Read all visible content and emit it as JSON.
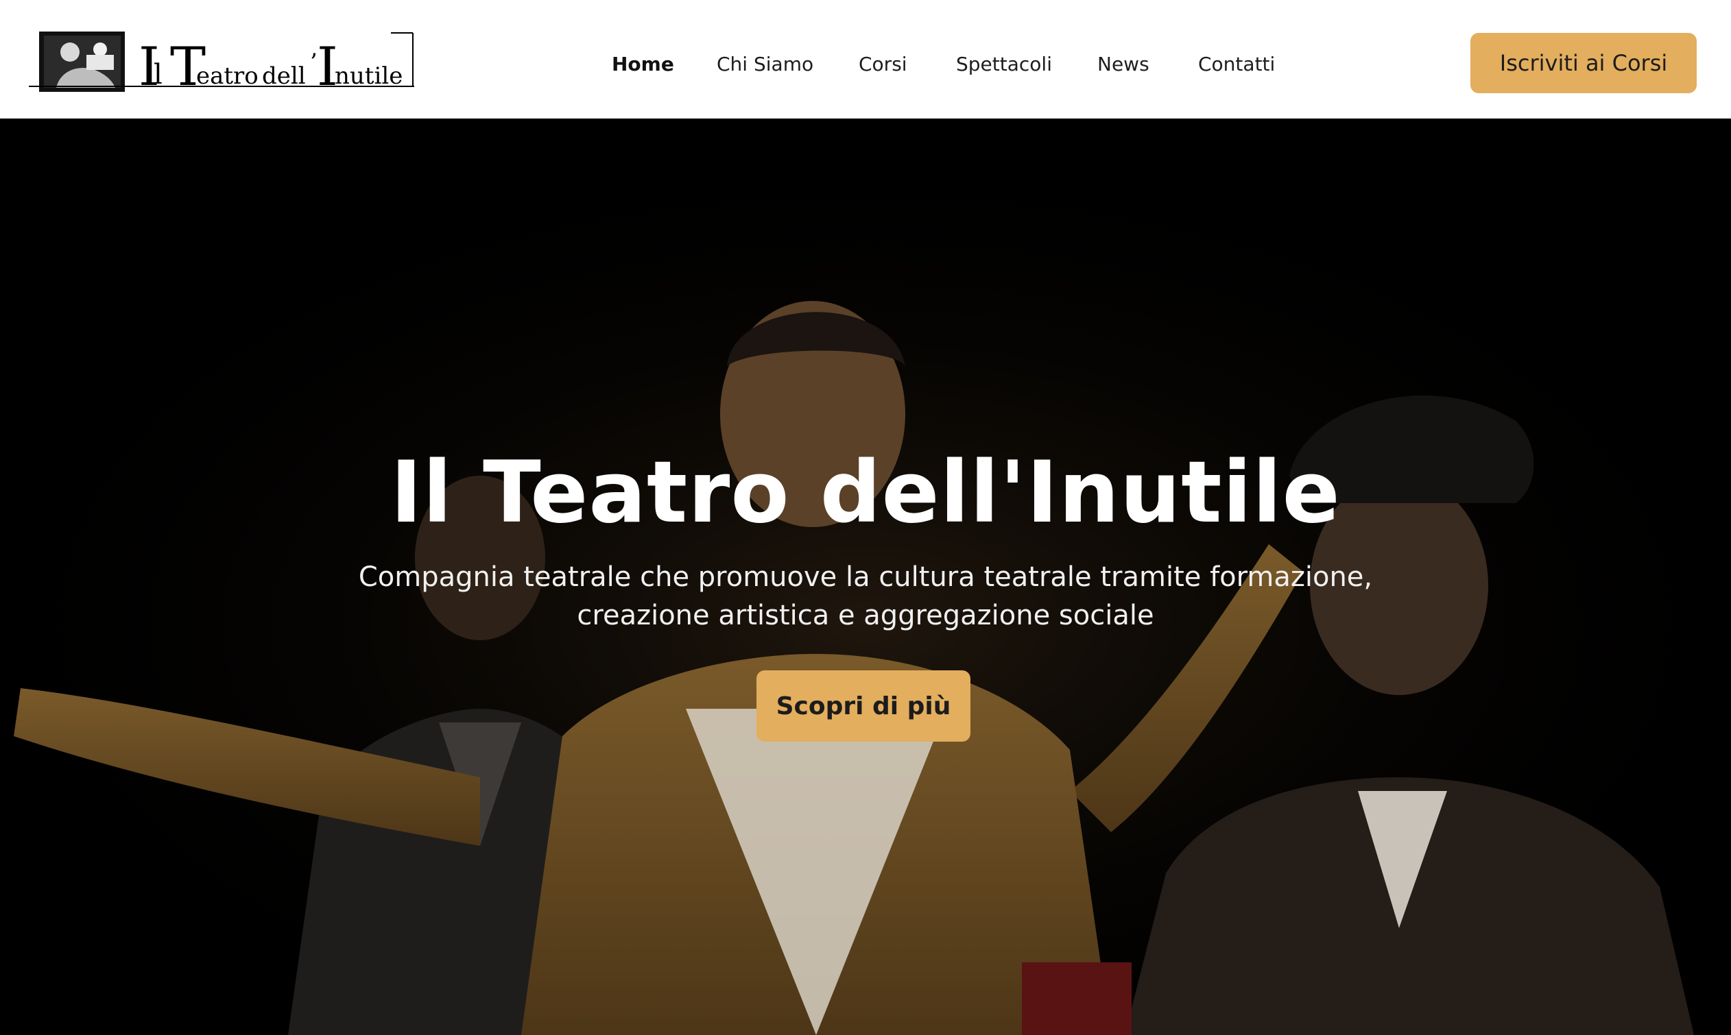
{
  "header": {
    "logo_alt": "Il Teatro dell'Inutile",
    "nav": [
      {
        "label": "Home",
        "active": true
      },
      {
        "label": "Chi Siamo",
        "active": false
      },
      {
        "label": "Corsi",
        "active": false
      },
      {
        "label": "Spettacoli",
        "active": false
      },
      {
        "label": "News",
        "active": false
      },
      {
        "label": "Contatti",
        "active": false
      }
    ],
    "cta_label": "Iscriviti ai Corsi"
  },
  "hero": {
    "title": "Il Teatro dell'Inutile",
    "subtitle_line1": "Compagnia teatrale che promuove la cultura teatrale tramite formazione,",
    "subtitle_line2": "creazione artistica e aggregazione sociale",
    "cta_label": "Scopri di più"
  },
  "colors": {
    "accent": "#e3ae5d",
    "header_bg": "#ffffff",
    "hero_bg": "#000000",
    "text_dark": "#1c1c1c"
  }
}
